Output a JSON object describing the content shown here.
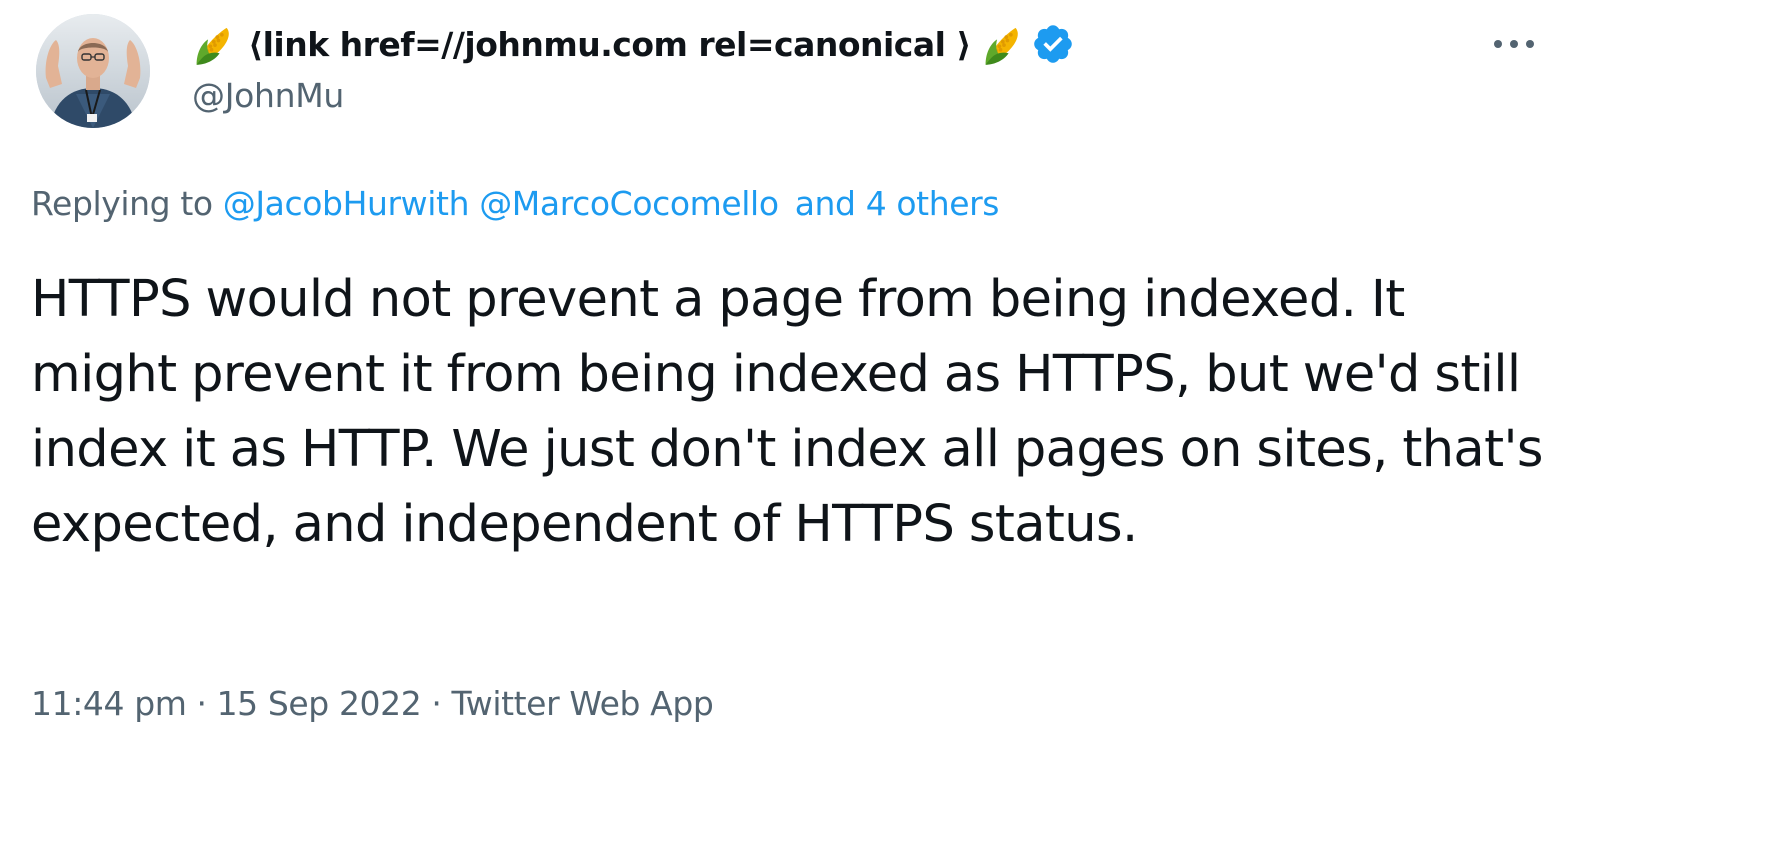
{
  "author": {
    "display_name": "⟨link href=//johnmu.com rel=canonical ⟩",
    "handle": "@JohnMu",
    "verified": true,
    "name_emoji": "corn-icon"
  },
  "reply": {
    "prefix": "Replying to",
    "mentions": [
      "@JacobHurwith",
      "@MarcoCocomello"
    ],
    "others": "and 4 others"
  },
  "tweet": {
    "text": "HTTPS would not prevent a page from being indexed. It might prevent it from being indexed as HTTPS, but we'd still index it as HTTP. We just don't index all pages on sites, that's expected, and independent of HTTPS status."
  },
  "meta": {
    "time": "11:44 pm",
    "separator": "·",
    "date": "15 Sep 2022",
    "source": "Twitter Web App"
  },
  "colors": {
    "accent": "#1d9bf0",
    "secondary_text": "#536471",
    "primary_text": "#0f1419"
  },
  "icons": {
    "more": "more-options-icon",
    "verified": "verified-badge-icon",
    "avatar": "avatar"
  }
}
